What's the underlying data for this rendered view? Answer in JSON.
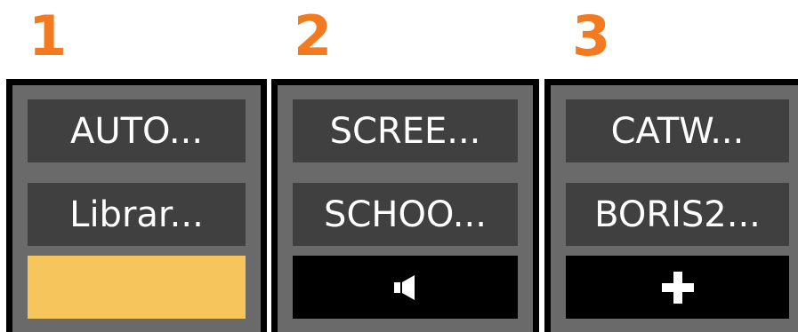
{
  "panels": [
    {
      "number": "1",
      "slots": [
        "AUTO...",
        "Librar..."
      ],
      "bottom": {
        "style": "yellow",
        "icon": "none",
        "color": "#f6c65c"
      }
    },
    {
      "number": "2",
      "slots": [
        "SCREE...",
        "SCHOO..."
      ],
      "bottom": {
        "style": "black",
        "icon": "speaker-icon"
      }
    },
    {
      "number": "3",
      "slots": [
        "CATW...",
        "BORIS2..."
      ],
      "bottom": {
        "style": "black",
        "icon": "plus-icon"
      }
    }
  ],
  "colors": {
    "number": "#f47a20",
    "panel_bg": "#6a6a6a",
    "slot_bg": "#404040",
    "slot_text": "#ffffff",
    "border": "#000000"
  }
}
